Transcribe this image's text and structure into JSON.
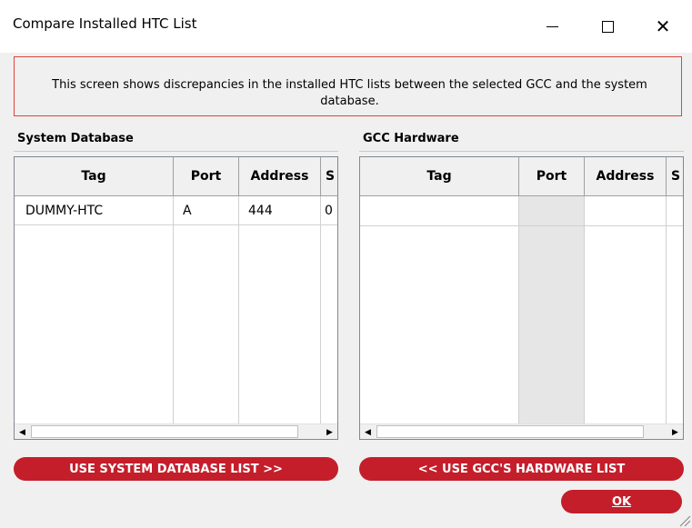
{
  "window": {
    "title": "Compare Installed HTC List",
    "minimize_glyph": "—",
    "close_glyph": "✕"
  },
  "banner": {
    "text": "This screen shows discrepancies in the installed HTC lists between the selected GCC and the system database."
  },
  "system_pane": {
    "header": "System Database",
    "columns": [
      "Tag",
      "Port",
      "Address",
      "S"
    ],
    "rows": [
      {
        "tag": "DUMMY-HTC",
        "port": "A",
        "address": "444",
        "s": "0"
      }
    ]
  },
  "gcc_pane": {
    "header": "GCC Hardware",
    "columns": [
      "Tag",
      "Port",
      "Address",
      "S"
    ],
    "rows": []
  },
  "buttons": {
    "use_system": "USE SYSTEM DATABASE LIST >>",
    "use_gcc": "<< USE GCC'S HARDWARE LIST",
    "ok": "OK"
  },
  "colors": {
    "button_red": "#c41e2a",
    "banner_border": "#e0433b",
    "port_column_shade": "#e6e6e6"
  }
}
